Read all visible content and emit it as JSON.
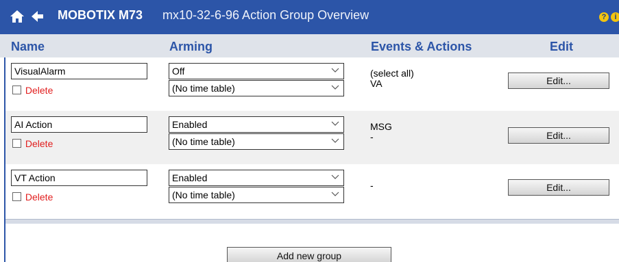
{
  "header": {
    "brand": "MOBOTIX M73",
    "subtitle": "mx10-32-6-96 Action Group Overview",
    "icons": [
      "home-icon",
      "back-arrow-icon",
      "help-icon",
      "info-icon"
    ],
    "help_glyph": "?",
    "info_glyph": "i"
  },
  "columns": {
    "name": "Name",
    "arming": "Arming",
    "events": "Events & Actions",
    "edit": "Edit"
  },
  "groups": [
    {
      "name": "VisualAlarm",
      "delete_label": "Delete",
      "arming": "Off",
      "time_table": "(No time table)",
      "events_line1": "(select all)",
      "events_line2": "VA",
      "edit_label": "Edit..."
    },
    {
      "name": "AI Action",
      "delete_label": "Delete",
      "arming": "Enabled",
      "time_table": "(No time table)",
      "events_line1": "MSG",
      "events_line2": "-",
      "edit_label": "Edit..."
    },
    {
      "name": "VT Action",
      "delete_label": "Delete",
      "arming": "Enabled",
      "time_table": "(No time table)",
      "events_line1": "",
      "events_line2": "-",
      "edit_label": "Edit..."
    }
  ],
  "add_group_label": "Add new group",
  "colors": {
    "header_bg": "#2c55a8",
    "column_head_text": "#2c55a8",
    "delete_text": "#e11d1d",
    "icon_yellow": "#f2c40f"
  }
}
